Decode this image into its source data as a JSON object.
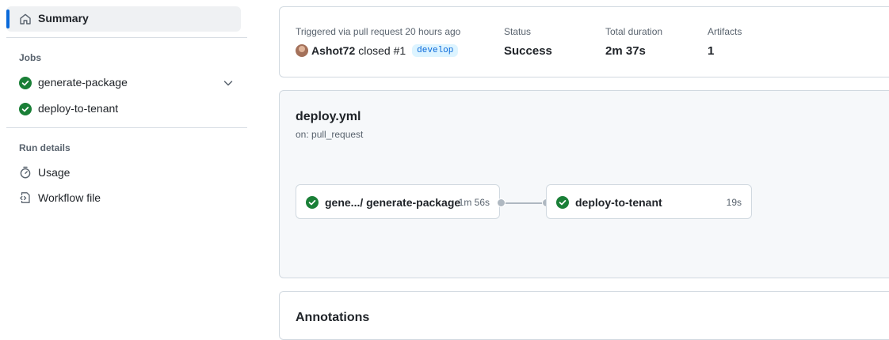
{
  "colors": {
    "accent": "#0969da",
    "success": "#1a7f37",
    "muted": "#59636e",
    "border": "#d1d9e0"
  },
  "sidebar": {
    "summary": {
      "label": "Summary",
      "icon": "home-icon"
    },
    "jobs_heading": "Jobs",
    "jobs": [
      {
        "label": "generate-package",
        "status_icon": "check-circle-icon",
        "has_chevron": true
      },
      {
        "label": "deploy-to-tenant",
        "status_icon": "check-circle-icon"
      }
    ],
    "run_details_heading": "Run details",
    "details": [
      {
        "label": "Usage",
        "icon": "stopwatch-icon"
      },
      {
        "label": "Workflow file",
        "icon": "file-code-icon"
      }
    ]
  },
  "run_summary": {
    "trigger_label": "Triggered via pull request 20 hours ago",
    "user": "Ashot72",
    "action": "closed #1",
    "branch": "develop",
    "status_label": "Status",
    "status_value": "Success",
    "duration_label": "Total duration",
    "duration_value": "2m 37s",
    "artifacts_label": "Artifacts",
    "artifacts_value": "1"
  },
  "workflow": {
    "name": "deploy.yml",
    "trigger": "on: pull_request",
    "jobs": [
      {
        "name": "gene.../ generate-package",
        "duration": "1m 56s"
      },
      {
        "name": "deploy-to-tenant",
        "duration": "19s"
      }
    ]
  },
  "annotations": {
    "title": "Annotations"
  }
}
